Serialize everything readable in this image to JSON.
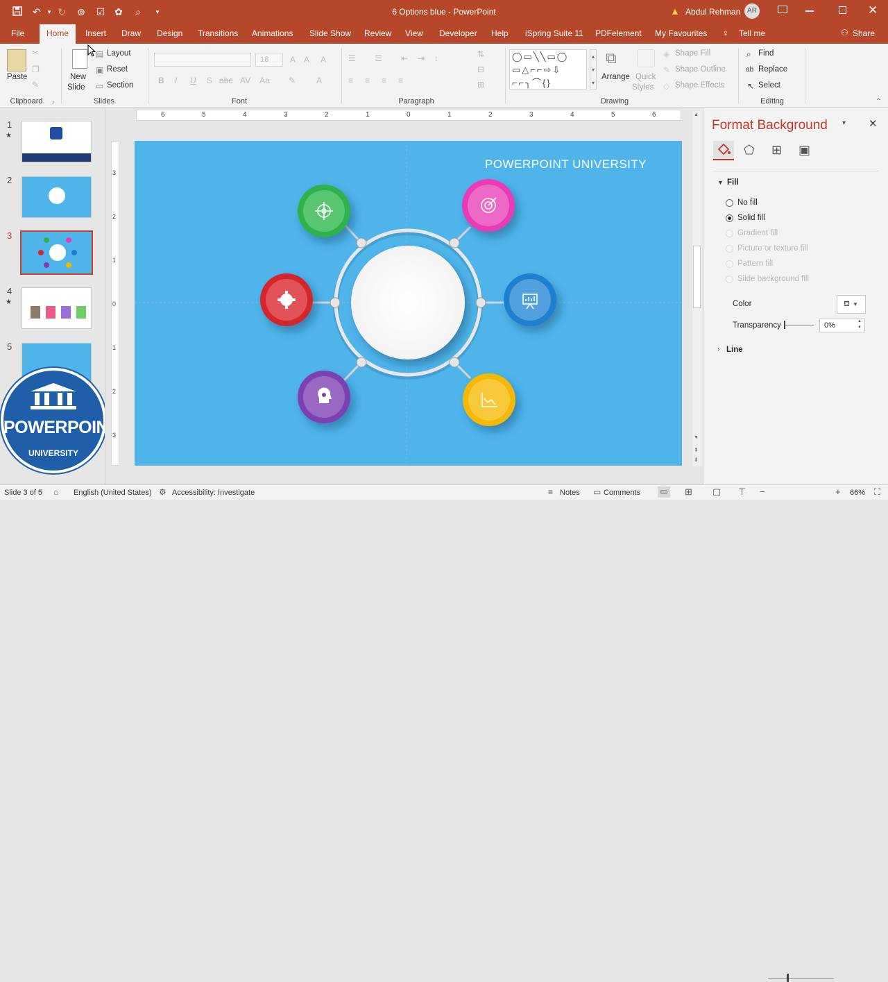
{
  "window": {
    "title": "6 Options blue  -  PowerPoint",
    "user_name": "Abdul Rehman",
    "user_initials": "AR",
    "accent": "#b7472a"
  },
  "tabs": [
    "File",
    "Home",
    "Insert",
    "Draw",
    "Design",
    "Transitions",
    "Animations",
    "Slide Show",
    "Review",
    "View",
    "Developer",
    "Help",
    "iSpring Suite 11",
    "PDFelement",
    "My Favourites",
    "Tell me"
  ],
  "share": "Share",
  "ribbon": {
    "clipboard": {
      "paste": "Paste",
      "group": "Clipboard"
    },
    "slides": {
      "new_slide_line1": "New",
      "new_slide_line2": "Slide",
      "layout": "Layout",
      "reset": "Reset",
      "section": "Section",
      "group": "Slides"
    },
    "font": {
      "size": "18",
      "group": "Font"
    },
    "paragraph": {
      "group": "Paragraph"
    },
    "drawing": {
      "arrange": "Arrange",
      "quick_styles_1": "Quick",
      "quick_styles_2": "Styles",
      "shape_fill": "Shape Fill",
      "shape_outline": "Shape Outline",
      "shape_effects": "Shape Effects",
      "group": "Drawing"
    },
    "editing": {
      "find": "Find",
      "replace": "Replace",
      "select": "Select",
      "group": "Editing"
    }
  },
  "thumbnails": [
    {
      "num": "1",
      "star": "★"
    },
    {
      "num": "2",
      "star": ""
    },
    {
      "num": "3",
      "star": ""
    },
    {
      "num": "4",
      "star": "★"
    },
    {
      "num": "5",
      "star": ""
    }
  ],
  "watermark": {
    "top": "POWERPOINT",
    "bottom": "UNIVERSITY"
  },
  "slide": {
    "brand": "POWERPOINT UNIVERSITY",
    "background": "#4fb4ea",
    "options": [
      {
        "icon": "target-crosshair-icon",
        "color": "#2db24a"
      },
      {
        "icon": "bullseye-icon",
        "color": "#e83ab5"
      },
      {
        "icon": "gear-icon",
        "color": "#d3252b"
      },
      {
        "icon": "presentation-icon",
        "color": "#1e7fcf"
      },
      {
        "icon": "brain-head-icon",
        "color": "#7b3fb0"
      },
      {
        "icon": "chart-icon",
        "color": "#f6b800"
      }
    ]
  },
  "ruler": {
    "h": [
      "6",
      "5",
      "4",
      "3",
      "2",
      "1",
      "0",
      "1",
      "2",
      "3",
      "4",
      "5",
      "6"
    ],
    "v": [
      "3",
      "2",
      "1",
      "0",
      "1",
      "2",
      "3"
    ]
  },
  "format_pane": {
    "title": "Format Background",
    "fill_section": "Fill",
    "options": [
      {
        "label": "No fill",
        "state": "off"
      },
      {
        "label": "Solid fill",
        "state": "on"
      },
      {
        "label": "Gradient fill",
        "state": "dim"
      },
      {
        "label": "Picture or texture fill",
        "state": "dim"
      },
      {
        "label": "Pattern fill",
        "state": "dim"
      },
      {
        "label": "Slide background fill",
        "state": "dim"
      }
    ],
    "color_label": "Color",
    "transparency_label": "Transparency",
    "transparency_value": "0%",
    "line_section": "Line"
  },
  "status": {
    "slide_info": "Slide 3 of 5",
    "language": "English (United States)",
    "accessibility": "Accessibility: Investigate",
    "notes": "Notes",
    "comments": "Comments",
    "zoom": "66%"
  }
}
